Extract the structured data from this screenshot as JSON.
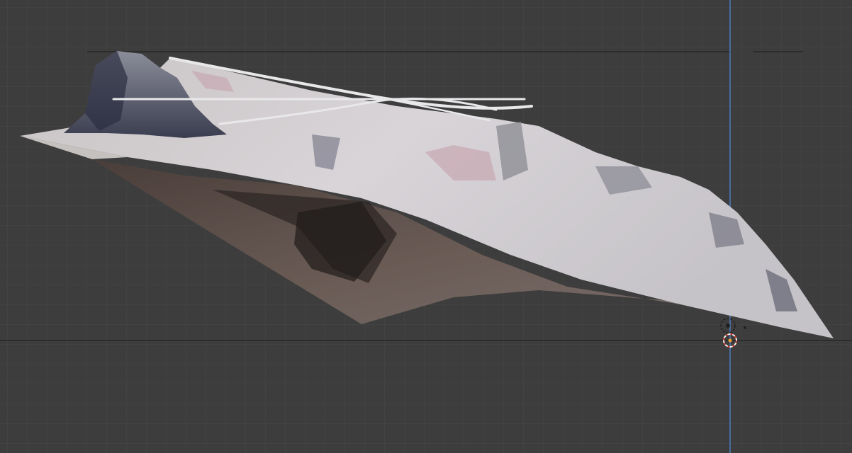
{
  "viewport": {
    "view": "3d-viewport",
    "grid_visible": true,
    "colors": {
      "background": "#3d3d3d",
      "grid_minor": "#474747",
      "grid_major": "#4a4a4a",
      "vertical_axis": "#4f7bbd",
      "horizon_line": "#1a1a1a",
      "cursor_ring": "#cf3b2b",
      "origin_dot": "#f0a030"
    },
    "objects": [
      {
        "name": "terrain-mesh",
        "kind": "textured-mesh"
      },
      {
        "name": "rail-lines",
        "kind": "curve-objects"
      },
      {
        "name": "light-object",
        "kind": "light"
      },
      {
        "name": "3d-cursor",
        "kind": "cursor"
      }
    ]
  }
}
